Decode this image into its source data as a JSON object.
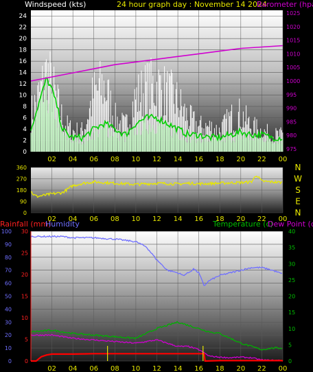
{
  "header": {
    "left_label": "Windspeed (kts)",
    "center_label": "24 hour graph day : November 14 2024",
    "right_label": "Barometer (hpa)"
  },
  "colors": {
    "wind_gust": "#ffffff",
    "wind_avg": "#00d000",
    "wind_speed": "#c8ffc8",
    "barometer": "#d000d0",
    "direction": "#e8e800",
    "humidity": "#6f6fff",
    "temperature": "#00b000",
    "dewpoint": "#d000d0",
    "rainfall": "#ff0000",
    "axis_white": "#ffffff",
    "axis_yellow": "#e8e800",
    "axis_magenta": "#d000d0",
    "axis_blue": "#6f6fff",
    "axis_green": "#00c000",
    "axis_red": "#ff2020"
  },
  "chart_data": [
    {
      "type": "line",
      "title": "24 hour graph day : November 14 2024",
      "ylabel": "Windspeed (kts)",
      "y2label": "Barometer (hpa)",
      "x_ticks": [
        "02",
        "04",
        "06",
        "08",
        "10",
        "12",
        "14",
        "16",
        "18",
        "20",
        "22",
        "00"
      ],
      "xlim": [
        0,
        24
      ],
      "ylim": [
        0,
        25
      ],
      "y_ticks": [
        0,
        2,
        4,
        6,
        8,
        10,
        12,
        14,
        16,
        18,
        20,
        22,
        24
      ],
      "y2lim": [
        974,
        1026
      ],
      "y2_ticks": [
        975,
        980,
        985,
        990,
        995,
        1000,
        1005,
        1010,
        1015,
        1020,
        1025
      ],
      "series": [
        {
          "name": "Gust",
          "x": [
            0,
            0.5,
            1,
            1.5,
            2,
            2.5,
            3,
            3.5,
            4,
            5,
            6,
            7,
            8,
            9,
            10,
            11,
            12,
            13,
            14,
            15,
            16,
            17,
            18,
            19,
            20,
            21,
            22,
            23,
            24
          ],
          "values": [
            9,
            12,
            15,
            19,
            16,
            12,
            8,
            6,
            5,
            5,
            14,
            16,
            8,
            6,
            13,
            15,
            16,
            14,
            12,
            8,
            6,
            6,
            5,
            8,
            9,
            6,
            5,
            4,
            4
          ]
        },
        {
          "name": "Average",
          "x": [
            0,
            0.5,
            1,
            1.5,
            2,
            2.5,
            3,
            3.5,
            4,
            5,
            6,
            7,
            8,
            9,
            10,
            11,
            12,
            13,
            14,
            15,
            16,
            17,
            18,
            19,
            20,
            21,
            22,
            23,
            24
          ],
          "values": [
            4,
            7,
            10,
            13,
            11,
            8,
            4,
            3,
            2.5,
            2.5,
            4,
            5,
            4,
            3,
            5,
            6,
            6,
            5,
            4,
            3,
            3,
            2.5,
            2.5,
            3,
            3.5,
            3,
            3,
            2.5,
            2.5
          ]
        },
        {
          "name": "Barometer",
          "axis": "y2",
          "x": [
            0,
            2,
            4,
            6,
            8,
            10,
            12,
            14,
            16,
            18,
            20,
            22,
            24
          ],
          "values": [
            1000,
            1001.5,
            1003,
            1004.5,
            1006,
            1007,
            1008,
            1009,
            1010,
            1011,
            1012,
            1012.5,
            1013
          ]
        }
      ]
    },
    {
      "type": "line",
      "ylabel": "Wind direction",
      "x_ticks": [
        "02",
        "04",
        "06",
        "08",
        "10",
        "12",
        "14",
        "16",
        "18",
        "20",
        "22",
        "00"
      ],
      "xlim": [
        0,
        24
      ],
      "ylim": [
        0,
        360
      ],
      "y_ticks": [
        0,
        90,
        180,
        270,
        360
      ],
      "compass": [
        "N",
        "W",
        "S",
        "E",
        "N"
      ],
      "series": [
        {
          "name": "Direction",
          "x": [
            0,
            0.3,
            0.6,
            1,
            2,
            3,
            4,
            5,
            6,
            7,
            8,
            9,
            10,
            11,
            12,
            13,
            14,
            15,
            16,
            17,
            18,
            19,
            20,
            21,
            21.5,
            22,
            23,
            24
          ],
          "values": [
            170,
            140,
            130,
            135,
            150,
            160,
            215,
            235,
            245,
            240,
            235,
            230,
            225,
            230,
            235,
            232,
            228,
            235,
            230,
            232,
            235,
            238,
            240,
            245,
            300,
            250,
            245,
            240
          ]
        }
      ]
    },
    {
      "type": "line",
      "x_ticks": [
        "02",
        "04",
        "06",
        "08",
        "10",
        "12",
        "14",
        "16",
        "18",
        "20",
        "22",
        "00"
      ],
      "xlim": [
        0,
        24
      ],
      "ylabel": "Rainfall (mm)",
      "ylim": [
        0,
        30
      ],
      "y_ticks": [
        0,
        5,
        10,
        15,
        20,
        25,
        30
      ],
      "humidity_label": "Humidity",
      "humidity_lim": [
        0,
        100
      ],
      "humidity_ticks": [
        0,
        10,
        20,
        30,
        40,
        50,
        60,
        70,
        80,
        90,
        100
      ],
      "y2label": "Temperature (c)",
      "dewpoint_label": "Dew Point (c)",
      "y2lim": [
        0,
        40
      ],
      "y2_ticks": [
        0,
        5,
        10,
        15,
        20,
        25,
        30,
        35,
        40
      ],
      "series": [
        {
          "name": "Humidity",
          "axis": "humidity",
          "x": [
            0,
            2,
            3,
            4,
            6,
            8,
            9,
            10,
            11,
            12,
            13,
            14,
            14.5,
            15,
            15.5,
            16,
            16.5,
            17,
            18,
            19,
            20,
            21,
            22,
            23,
            24
          ],
          "values": [
            96,
            96,
            96,
            95,
            95,
            94,
            93,
            92,
            88,
            78,
            70,
            68,
            66,
            68,
            71,
            68,
            58,
            62,
            66,
            68,
            70,
            72,
            72,
            70,
            67
          ]
        },
        {
          "name": "Temperature",
          "axis": "y2",
          "x": [
            0,
            2,
            4,
            6,
            8,
            10,
            11,
            12,
            13,
            14,
            15,
            16,
            17,
            18,
            19,
            20,
            21,
            22,
            23,
            24
          ],
          "values": [
            9,
            9.5,
            8.5,
            8,
            7.5,
            7,
            8.5,
            10,
            11,
            12,
            11,
            10,
            9,
            8.5,
            7,
            5.5,
            4.5,
            3.5,
            4,
            4
          ]
        },
        {
          "name": "Dew Point",
          "axis": "y2",
          "x": [
            0,
            2,
            4,
            6,
            8,
            10,
            11,
            12,
            13,
            14,
            15,
            16,
            16.5,
            17,
            18,
            19,
            20,
            21,
            22,
            23,
            24
          ],
          "values": [
            8,
            8,
            7,
            6.5,
            6,
            5.5,
            6,
            6.5,
            5.5,
            4.5,
            4.5,
            3.5,
            2.5,
            1.5,
            1.2,
            1,
            1.2,
            1,
            0.3,
            0.2,
            0.2
          ]
        },
        {
          "name": "Rainfall",
          "axis": "y",
          "x": [
            0,
            0.5,
            1,
            1.5,
            2,
            4,
            6,
            8,
            10,
            12,
            14,
            16,
            16.5,
            16.6,
            18,
            20,
            22,
            23,
            23.9,
            24
          ],
          "values": [
            0,
            0,
            1,
            1.4,
            1.6,
            1.6,
            1.7,
            1.7,
            1.7,
            1.7,
            1.7,
            1.7,
            1.7,
            0,
            0.1,
            0.1,
            0.1,
            0.1,
            0.1,
            0
          ]
        }
      ],
      "rain_events": [
        7.3,
        16.4
      ]
    }
  ]
}
